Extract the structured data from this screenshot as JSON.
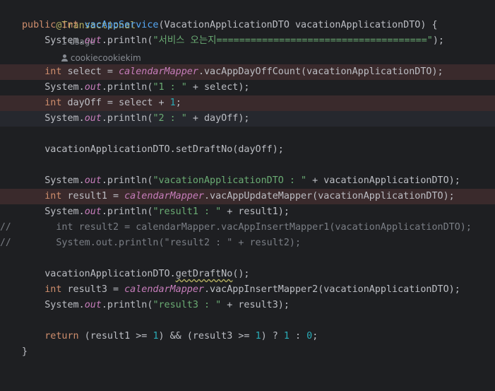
{
  "editor": {
    "lines": [
      {
        "annotation": "@Transactional",
        "usages": "1 usage",
        "author": "cookiecookiekim"
      },
      {
        "kw_public": "public",
        "kw_int": "int",
        "method": "vacAppService",
        "params": "(VacationApplicationDTO vacationApplicationDTO) {"
      },
      {
        "pre": "System.",
        "field": "out",
        "mid": ".println(",
        "str": "\"서비스 오는지=====================================\"",
        "end": ");"
      },
      {},
      {
        "kw": "int",
        "a": " select = ",
        "field": "calendarMapper",
        "b": ".vacAppDayOffCount(vacationApplicationDTO);"
      },
      {
        "pre": "System.",
        "field": "out",
        "mid": ".println(",
        "str": "\"1 : \"",
        "end": " + select);"
      },
      {
        "kw": "int",
        "a": " dayOff = select + ",
        "num": "1",
        "b": ";"
      },
      {
        "pre": "System.",
        "field": "out",
        "mid": ".println(",
        "str": "\"2 : \"",
        "end": " + dayOff);"
      },
      {},
      {
        "text": "vacationApplicationDTO.setDraftNo(dayOff);"
      },
      {},
      {
        "pre": "System.",
        "field": "out",
        "mid": ".println(",
        "str": "\"vacationApplicationDTO : \"",
        "end": " + vacationApplicationDTO);"
      },
      {
        "kw": "int",
        "a": " result1 = ",
        "field": "calendarMapper",
        "b": ".vacAppUpdateMapper(vacationApplicationDTO);"
      },
      {
        "pre": "System.",
        "field": "out",
        "mid": ".println(",
        "str": "\"result1 : \"",
        "end": " + result1);"
      },
      {
        "gutter": "//",
        "text": "int result2 = calendarMapper.vacAppInsertMapper1(vacationApplicationDTO);"
      },
      {
        "gutter": "//",
        "text": "System.out.println(\"result2 : \" + result2);"
      },
      {},
      {
        "a": "vacationApplicationDTO.",
        "warn": "getDraftNo",
        "b": "();"
      },
      {
        "kw": "int",
        "a": " result3 = ",
        "field": "calendarMapper",
        "b": ".vacAppInsertMapper2(vacationApplicationDTO);"
      },
      {
        "pre": "System.",
        "field": "out",
        "mid": ".println(",
        "str": "\"result3 : \"",
        "end": " + result3);"
      },
      {},
      {
        "kw": "return",
        "a": " (result1 >= ",
        "n1": "1",
        "b": ") && (result3 >= ",
        "n2": "1",
        "c": ") ? ",
        "n3": "1",
        "d": " : ",
        "n4": "0",
        "e": ";"
      },
      {
        "text": "}"
      }
    ]
  }
}
